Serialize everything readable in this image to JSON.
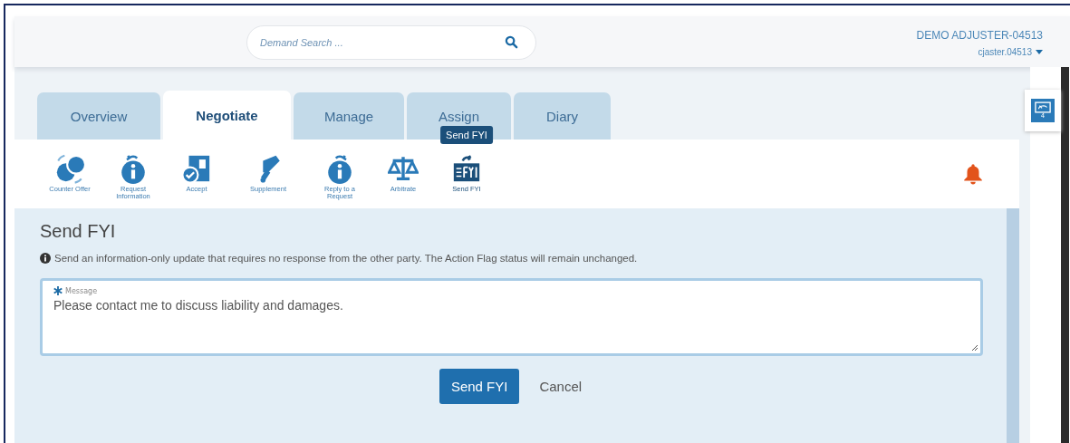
{
  "header": {
    "search": {
      "placeholder": "Demand Search ..."
    },
    "user": {
      "name": "DEMO ADJUSTER-04513",
      "login": "cjaster.04513"
    }
  },
  "tabs": [
    {
      "label": "Overview",
      "selected": false
    },
    {
      "label": "Negotiate",
      "selected": true
    },
    {
      "label": "Manage",
      "selected": false
    },
    {
      "label": "Assign",
      "selected": false
    },
    {
      "label": "Diary",
      "selected": false
    }
  ],
  "tooltip": "Send FYI",
  "actions": [
    {
      "kind": "counter",
      "label": "Counter Offer",
      "selected": false
    },
    {
      "kind": "request",
      "label": "Request Information",
      "selected": false
    },
    {
      "kind": "accept",
      "label": "Accept",
      "selected": false
    },
    {
      "kind": "supplement",
      "label": "Supplement",
      "selected": false
    },
    {
      "kind": "reply",
      "label": "Reply to a Request",
      "selected": false
    },
    {
      "kind": "arbitrate",
      "label": "Arbitrate",
      "selected": false
    },
    {
      "kind": "fyi",
      "label": "Send FYI",
      "selected": true
    }
  ],
  "side_widget": {
    "badge": "4"
  },
  "form": {
    "title": "Send FYI",
    "info": "Send an information-only update that requires no response from the other party. The Action Flag status will remain unchanged.",
    "field": {
      "label": "Message",
      "required": true,
      "value": "Please contact me to discuss liability and damages."
    },
    "buttons": [
      {
        "kind": "primary",
        "label": "Send FYI"
      },
      {
        "kind": "link",
        "label": "Cancel"
      }
    ]
  }
}
